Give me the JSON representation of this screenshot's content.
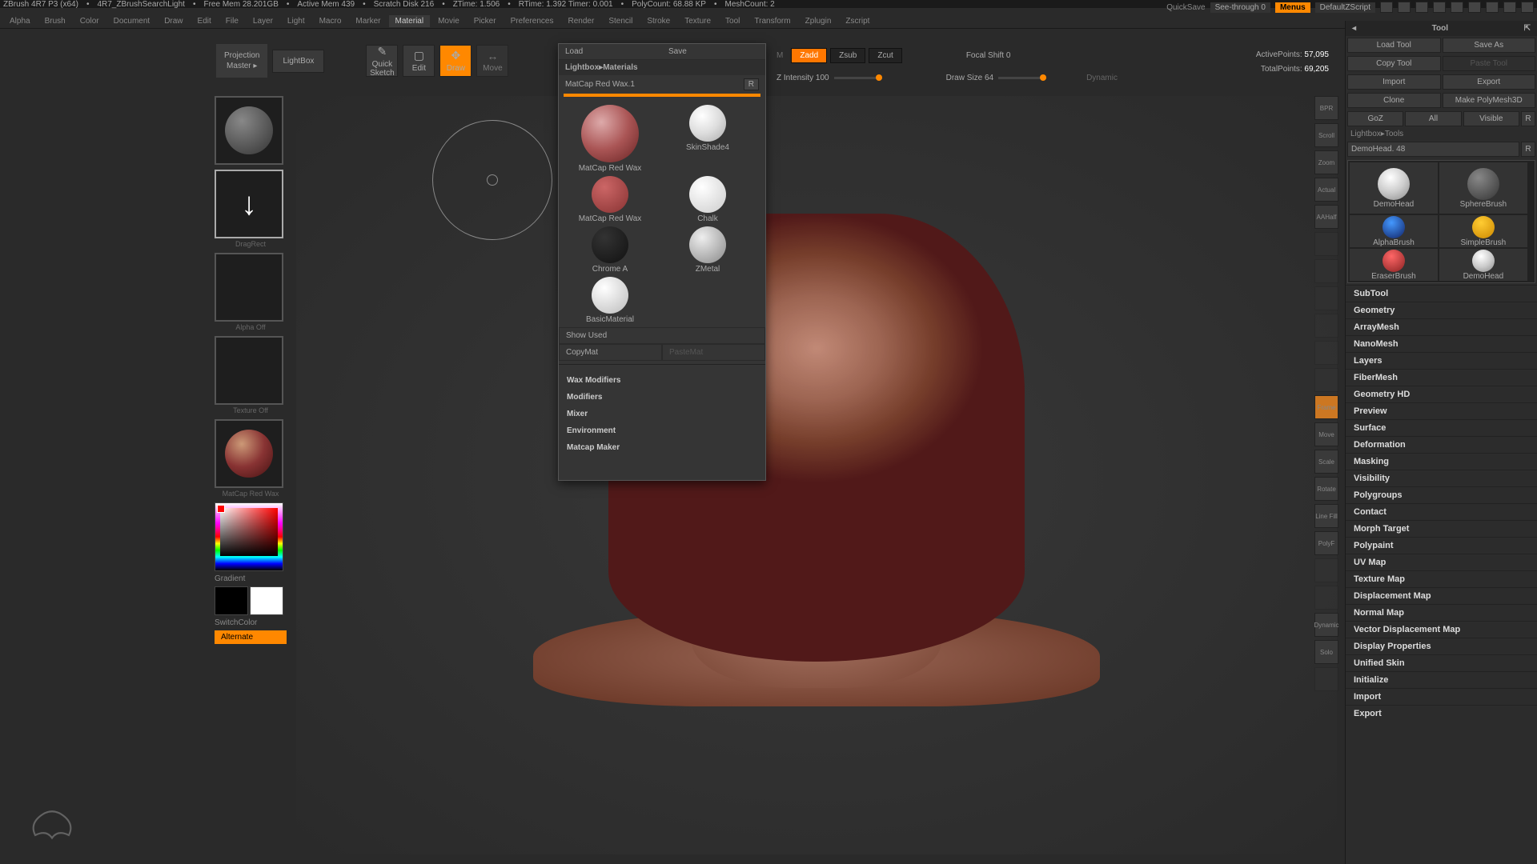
{
  "titlebar": {
    "segments": [
      "ZBrush 4R7 P3 (x64)",
      "4R7_ZBrushSearchLight",
      "Free Mem 28.201GB",
      "Active Mem 439",
      "Scratch Disk 216",
      "ZTime: 1.506",
      "RTime: 1.392 Timer: 0.001",
      "PolyCount: 68.88 KP",
      "MeshCount: 2"
    ]
  },
  "topright": {
    "quicksave": "QuickSave",
    "seethrough": "See-through  0",
    "menus": "Menus",
    "script": "DefaultZScript"
  },
  "menubar": [
    "Alpha",
    "Brush",
    "Color",
    "Document",
    "Draw",
    "Edit",
    "File",
    "Layer",
    "Light",
    "Macro",
    "Marker",
    "Material",
    "Movie",
    "Picker",
    "Preferences",
    "Render",
    "Stencil",
    "Stroke",
    "Texture",
    "Tool",
    "Transform",
    "Zplugin",
    "Zscript"
  ],
  "menubar_active": "Material",
  "toolbar": {
    "projection_a": "Projection",
    "projection_b": "Master",
    "lightbox": "LightBox",
    "quicksketch": "Quick Sketch",
    "edit": "Edit",
    "draw": "Draw",
    "move": "Move"
  },
  "midshelf": {
    "zadd": "Zadd",
    "zsub": "Zsub",
    "zcut": "Zcut",
    "focal": "Focal Shift 0",
    "zint": "Z Intensity 100",
    "dsize": "Draw Size 64",
    "dynamic": "Dynamic"
  },
  "info": {
    "active_lbl": "ActivePoints:",
    "active_val": "57,095",
    "total_lbl": "TotalPoints:",
    "total_val": "69,205"
  },
  "leftside": {
    "dragrect": "DragRect",
    "alphaoff": "Alpha Off",
    "textureoff": "Texture Off",
    "matname": "MatCap Red Wax",
    "gradient": "Gradient",
    "switchcolor": "SwitchColor",
    "alternate": "Alternate"
  },
  "material": {
    "load": "Load",
    "save": "Save",
    "lightbox": "Lightbox▸Materials",
    "name": "MatCap Red Wax.1",
    "r": "R",
    "mats": [
      {
        "key": "redwax",
        "label": "MatCap Red Wax"
      },
      {
        "key": "skin",
        "label": "SkinShade4"
      },
      {
        "key": "redsmall",
        "label": "MatCap Red Wax"
      },
      {
        "key": "chalk",
        "label": "Chalk"
      },
      {
        "key": "chrome",
        "label": "Chrome A"
      },
      {
        "key": "zmetal",
        "label": "ZMetal"
      },
      {
        "key": "basic",
        "label": "BasicMaterial"
      }
    ],
    "showused": "Show Used",
    "copymat": "CopyMat",
    "pastemat": "PasteMat",
    "sections": [
      "Wax Modifiers",
      "Modifiers",
      "Mixer",
      "Environment",
      "Matcap Maker"
    ]
  },
  "tool": {
    "title": "Tool",
    "rows": [
      [
        "Load Tool",
        "Save As"
      ],
      [
        "Copy Tool",
        "Paste Tool"
      ],
      [
        "Import",
        "Export"
      ],
      [
        "Clone",
        "Make PolyMesh3D"
      ],
      [
        "GoZ",
        "All",
        "Visible",
        "R"
      ]
    ],
    "lbtools": "Lightbox▸Tools",
    "current": "DemoHead. 48",
    "r": "R",
    "thumbs": [
      {
        "cls": "tb-head",
        "label": "DemoHead"
      },
      {
        "cls": "tb-sphere",
        "label": "SphereBrush"
      },
      {
        "cls": "tb-alpha",
        "label": "AlphaBrush"
      },
      {
        "cls": "tb-simple",
        "label": "SimpleBrush"
      },
      {
        "cls": "tb-eraser",
        "label": "EraserBrush"
      },
      {
        "cls": "tb-head",
        "label": "DemoHead"
      }
    ],
    "acc": [
      "SubTool",
      "Geometry",
      "ArrayMesh",
      "NanoMesh",
      "Layers",
      "FiberMesh",
      "Geometry HD",
      "Preview",
      "Surface",
      "Deformation",
      "Masking",
      "Visibility",
      "Polygroups",
      "Contact",
      "Morph Target",
      "Polypaint",
      "UV Map",
      "Texture Map",
      "Displacement Map",
      "Normal Map",
      "Vector Displacement Map",
      "Display Properties",
      "Unified Skin",
      "Initialize",
      "Import",
      "Export"
    ]
  },
  "sidetools": [
    "BPR",
    "Scroll",
    "Zoom",
    "Actual",
    "AAHalf",
    "",
    "",
    "",
    "",
    "",
    "",
    "Frame",
    "Move",
    "Scale",
    "Rotate",
    "Line Fill",
    "PolyF",
    "",
    "",
    "Dynamic",
    "Solo",
    ""
  ]
}
